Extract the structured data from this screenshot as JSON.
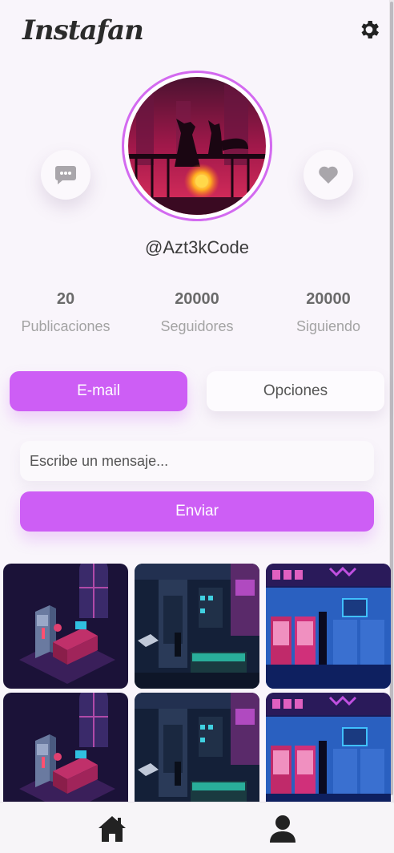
{
  "app": {
    "title": "Instafan"
  },
  "profile": {
    "username": "@Azt3kCode"
  },
  "stats": [
    {
      "value": "20",
      "label": "Publicaciones"
    },
    {
      "value": "20000",
      "label": "Seguidores"
    },
    {
      "value": "20000",
      "label": "Siguiendo"
    }
  ],
  "tabs": {
    "email": "E-mail",
    "options": "Opciones"
  },
  "message": {
    "placeholder": "Escribe un mensaje...",
    "send_label": "Enviar"
  },
  "colors": {
    "accent": "#cd5ef5",
    "ring": "#d36af0",
    "background": "#f9f5fb"
  },
  "icons": {
    "settings": "gear-icon",
    "message": "chat-bubble-icon",
    "like": "heart-icon",
    "home": "home-icon",
    "profile": "user-icon"
  },
  "gallery": [
    {
      "scene": "isometric-room"
    },
    {
      "scene": "neon-shop-interior"
    },
    {
      "scene": "arcade-storefront"
    },
    {
      "scene": "isometric-room"
    },
    {
      "scene": "neon-shop-interior"
    },
    {
      "scene": "arcade-storefront"
    }
  ]
}
